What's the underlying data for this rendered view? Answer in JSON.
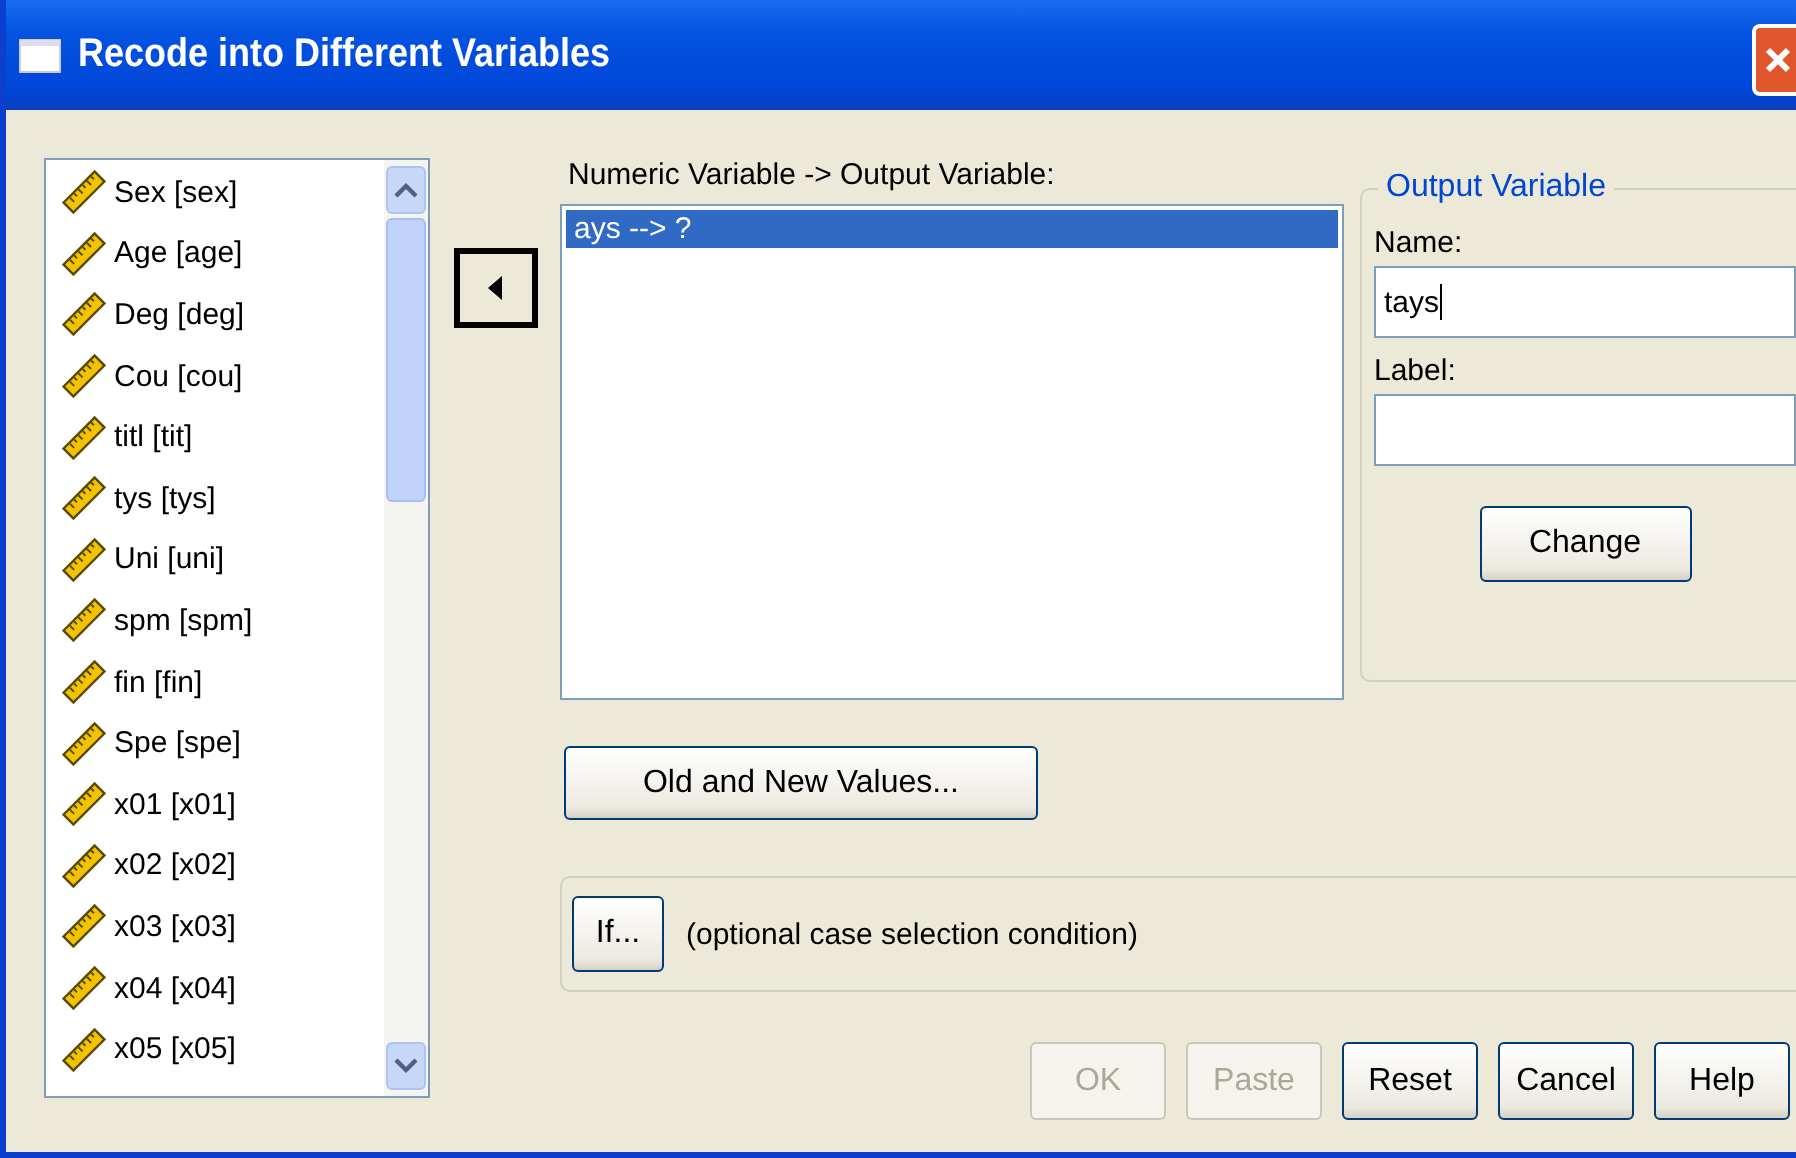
{
  "window": {
    "title": "Recode into Different Variables"
  },
  "variables": [
    {
      "label": "Sex  [sex]"
    },
    {
      "label": "Age   [age]"
    },
    {
      "label": "Deg [deg]"
    },
    {
      "label": "Cou [cou]"
    },
    {
      "label": "titl [tit]"
    },
    {
      "label": "tys [tys]"
    },
    {
      "label": "Uni [uni]"
    },
    {
      "label": "spm [spm]"
    },
    {
      "label": "fin [fin]"
    },
    {
      "label": "Spe [spe]"
    },
    {
      "label": "x01 [x01]"
    },
    {
      "label": "x02 [x02]"
    },
    {
      "label": "x03 [x03]"
    },
    {
      "label": "x04 [x04]"
    },
    {
      "label": "x05 [x05]"
    }
  ],
  "mapping": {
    "label": "Numeric Variable -> Output Variable:",
    "items": [
      {
        "text": "ays --> ?",
        "selected": true
      }
    ]
  },
  "output_variable": {
    "title": "Output Variable",
    "name_label": "Name:",
    "name_value": "tays",
    "label_label": "Label:",
    "change_button": "Change"
  },
  "old_new_button": "Old and New Values...",
  "if_section": {
    "button": "If...",
    "text": "(optional case selection condition)"
  },
  "buttons": [
    {
      "label": "OK",
      "disabled": true
    },
    {
      "label": "Paste",
      "disabled": true
    },
    {
      "label": "Reset",
      "disabled": false
    },
    {
      "label": "Cancel",
      "disabled": false
    },
    {
      "label": "Help",
      "disabled": false
    }
  ]
}
